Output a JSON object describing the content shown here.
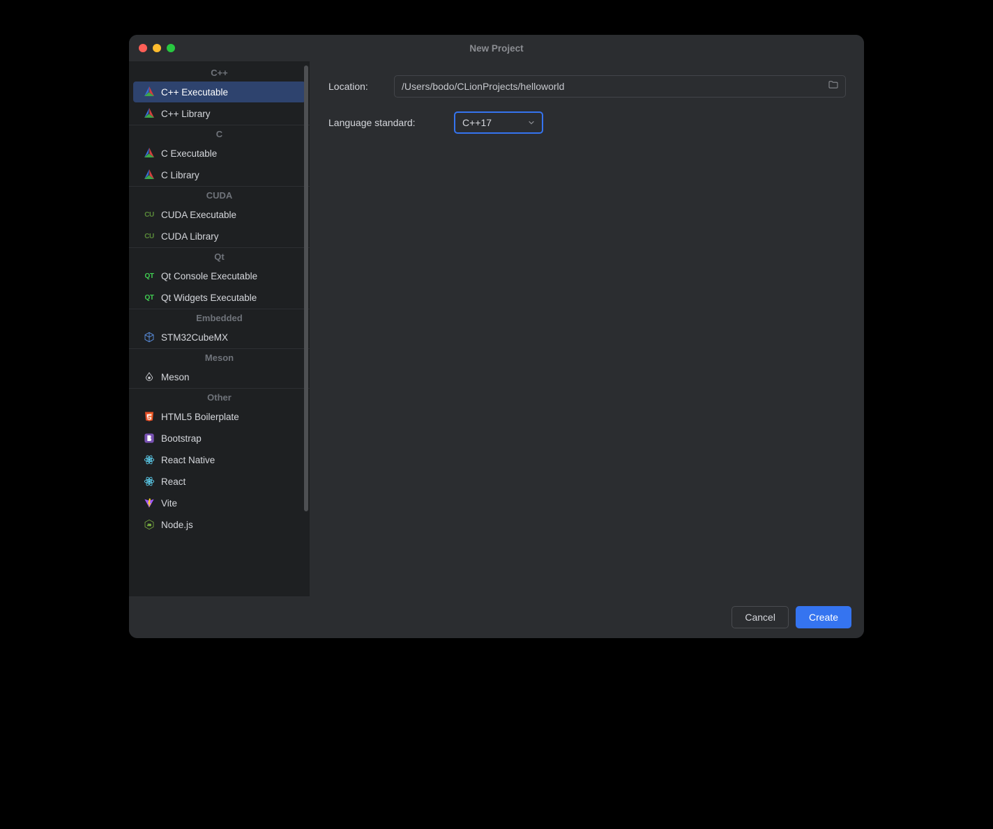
{
  "window": {
    "title": "New Project"
  },
  "sidebar": {
    "groups": [
      {
        "label": "C++",
        "items": [
          {
            "label": "C++ Executable",
            "icon": "cmake",
            "selected": true
          },
          {
            "label": "C++ Library",
            "icon": "cmake"
          }
        ]
      },
      {
        "label": "C",
        "items": [
          {
            "label": "C Executable",
            "icon": "cmake"
          },
          {
            "label": "C Library",
            "icon": "cmake"
          }
        ]
      },
      {
        "label": "CUDA",
        "items": [
          {
            "label": "CUDA Executable",
            "icon": "cu"
          },
          {
            "label": "CUDA Library",
            "icon": "cu"
          }
        ]
      },
      {
        "label": "Qt",
        "items": [
          {
            "label": "Qt Console Executable",
            "icon": "qt"
          },
          {
            "label": "Qt Widgets Executable",
            "icon": "qt"
          }
        ]
      },
      {
        "label": "Embedded",
        "items": [
          {
            "label": "STM32CubeMX",
            "icon": "cube"
          }
        ]
      },
      {
        "label": "Meson",
        "items": [
          {
            "label": "Meson",
            "icon": "meson"
          }
        ]
      },
      {
        "label": "Other",
        "items": [
          {
            "label": "HTML5 Boilerplate",
            "icon": "html5"
          },
          {
            "label": "Bootstrap",
            "icon": "bootstrap"
          },
          {
            "label": "React Native",
            "icon": "react"
          },
          {
            "label": "React",
            "icon": "react"
          },
          {
            "label": "Vite",
            "icon": "vite"
          },
          {
            "label": "Node.js",
            "icon": "node"
          }
        ]
      }
    ]
  },
  "form": {
    "location_label": "Location:",
    "location_value": "/Users/bodo/CLionProjects/helloworld",
    "language_standard_label": "Language standard:",
    "language_standard_value": "C++17"
  },
  "footer": {
    "cancel": "Cancel",
    "create": "Create"
  }
}
